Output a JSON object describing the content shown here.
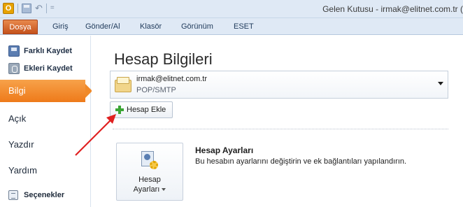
{
  "window": {
    "title": "Gelen Kutusu - irmak@elitnet.com.tr ("
  },
  "quick_access": {
    "app_icon_letter": "O",
    "more_glyph": "="
  },
  "ribbon": {
    "tabs": [
      "Dosya",
      "Giriş",
      "Gönder/Al",
      "Klasör",
      "Görünüm",
      "ESET"
    ],
    "active_tab": "Dosya",
    "active_color": "#d8621f"
  },
  "backstage_nav": {
    "actions": [
      {
        "label": "Farklı Kaydet",
        "icon": "save-as-icon"
      },
      {
        "label": "Ekleri Kaydet",
        "icon": "save-attachments-icon"
      }
    ],
    "items": [
      {
        "label": "Bilgi",
        "selected": true
      },
      {
        "label": "Açık"
      },
      {
        "label": "Yazdır"
      },
      {
        "label": "Yardım"
      },
      {
        "label": "Seçenekler",
        "icon": "options-icon"
      }
    ],
    "selected_color": "#f08a2a"
  },
  "main": {
    "title": "Hesap Bilgileri",
    "account": {
      "email": "irmak@elitnet.com.tr",
      "type": "POP/SMTP",
      "icon": "mail-account-icon"
    },
    "add_account_label": "Hesap Ekle",
    "settings": {
      "button_line1": "Hesap",
      "button_line2": "Ayarları",
      "heading": "Hesap Ayarları",
      "description": "Bu hesabın ayarlarını değiştirin ve ek bağlantıları yapılandırın.",
      "icon": "account-settings-icon"
    }
  },
  "annotation": {
    "arrow_color": "#e02020"
  }
}
